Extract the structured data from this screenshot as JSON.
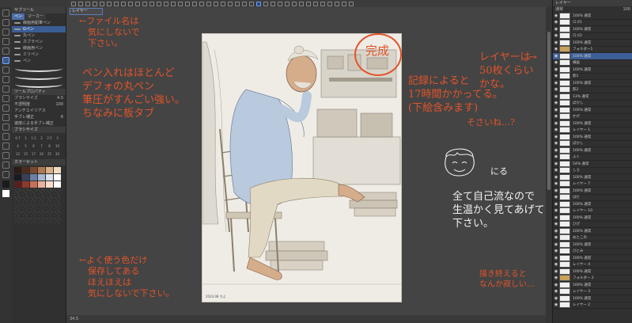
{
  "top_tab": "レイヤー",
  "left_panel": {
    "tab_header": "サブツール",
    "tabs": [
      "ペン",
      "マーカー"
    ],
    "brushes": [
      "線画用鉛筆ペン",
      "Gペン",
      "丸ペン",
      "カブラペン",
      "線画用ペン",
      "ミリペン",
      "ペン"
    ],
    "selected_brush_index": 1,
    "properties_header": "ツールプロパティ",
    "properties": [
      {
        "label": "ブラシサイズ",
        "value": "4.5"
      },
      {
        "label": "不透明度",
        "value": "100"
      },
      {
        "label": "アンチエイリアス",
        "value": ""
      },
      {
        "label": "手ブレ補正",
        "value": "6"
      },
      {
        "label": "速度による手ブレ補正",
        "value": ""
      }
    ],
    "size_header": "ブラシサイズ",
    "sizes": [
      "0.7",
      "1",
      "1.5",
      "2",
      "2.5",
      "3",
      "4",
      "5",
      "6",
      "7",
      "8",
      "10",
      "12",
      "15",
      "17",
      "20",
      "25",
      "30"
    ],
    "palette_header": "カラーセット",
    "swatch_colors": [
      "#2b1b14",
      "#4a2d1e",
      "#7a4a2e",
      "#b07a52",
      "#d8b08a",
      "#f1dcc2",
      "#1a1a22",
      "#3a3f58",
      "#6b7fa4",
      "#a9b8d2",
      "#d9e1ec",
      "#ffffff",
      "#5a1e1e",
      "#8c3a2a",
      "#c7705a",
      "#e8b29c",
      "#f6dccd",
      "#ffffff"
    ]
  },
  "tools_colors": {
    "main": "#1b1b1b",
    "sub": "#ffffff"
  },
  "canvas": {
    "tab_label": "レイヤー",
    "signature": "2024.08 ちよ"
  },
  "annotations": {
    "filename": "←ファイル名は\n　気にしないで\n　下さい。",
    "pens": "ペン入れはほとんど\nデフォの丸ペン\n筆圧がすんごい強い。\nちなみに板タブ",
    "colors": "←よく使う色だけ\n　保存してある\n　ほえほえは\n　気にしないで下さい。",
    "complete": "完成",
    "record": "記録によると\n17時間かかってる。\n(下絵含みます)",
    "suffix": "そさいね…?",
    "layers": "レイヤーは\n50枚くらい\nかな。",
    "smile": "にる",
    "free": "全て自己流なので\n生温かく見てあげて\n下さい。",
    "after": "描き終えると\nなんか寂しい…"
  },
  "status": {
    "zoom": "34.5"
  },
  "layers": [
    {
      "name": "100% 通常",
      "type": "layer"
    },
    {
      "name": "ロゴ1",
      "type": "layer"
    },
    {
      "name": "100% 通常",
      "type": "layer"
    },
    {
      "name": "ロゴ2",
      "type": "layer"
    },
    {
      "name": "100% 通常",
      "type": "layer"
    },
    {
      "name": "フォルダー1",
      "type": "folder"
    },
    {
      "name": "100% 通常",
      "type": "layer"
    },
    {
      "name": "線画",
      "type": "layer"
    },
    {
      "name": "100% 通常",
      "type": "layer"
    },
    {
      "name": "影1",
      "type": "layer"
    },
    {
      "name": "100% 通常",
      "type": "layer"
    },
    {
      "name": "影2",
      "type": "layer"
    },
    {
      "name": "13% 通常",
      "type": "layer"
    },
    {
      "name": "ぼかし",
      "type": "layer"
    },
    {
      "name": "100% 通常",
      "type": "layer"
    },
    {
      "name": "かげ",
      "type": "layer"
    },
    {
      "name": "100% 通常",
      "type": "layer"
    },
    {
      "name": "レイヤー 1",
      "type": "layer"
    },
    {
      "name": "100% 通常",
      "type": "layer"
    },
    {
      "name": "ぼかし",
      "type": "layer"
    },
    {
      "name": "100% 通常",
      "type": "layer"
    },
    {
      "name": "ふく",
      "type": "layer"
    },
    {
      "name": "54% 通常",
      "type": "layer"
    },
    {
      "name": "しろ",
      "type": "layer"
    },
    {
      "name": "100% 通常",
      "type": "layer"
    },
    {
      "name": "レイヤー 7",
      "type": "layer"
    },
    {
      "name": "100% 通常",
      "type": "layer"
    },
    {
      "name": "はだ",
      "type": "layer"
    },
    {
      "name": "100% 通常",
      "type": "layer"
    },
    {
      "name": "レイヤー 10",
      "type": "layer"
    },
    {
      "name": "100% 通常",
      "type": "layer"
    },
    {
      "name": "ひげ",
      "type": "layer"
    },
    {
      "name": "100% 通常",
      "type": "layer"
    },
    {
      "name": "おとこの",
      "type": "layer"
    },
    {
      "name": "100% 通常",
      "type": "layer"
    },
    {
      "name": "ひとみ",
      "type": "layer"
    },
    {
      "name": "100% 通常",
      "type": "layer"
    },
    {
      "name": "レイヤー 4",
      "type": "layer"
    },
    {
      "name": "100% 通常",
      "type": "layer"
    },
    {
      "name": "フォルダー 2",
      "type": "folder"
    },
    {
      "name": "100% 通常",
      "type": "layer"
    },
    {
      "name": "レイヤー 3",
      "type": "layer"
    },
    {
      "name": "100% 通常",
      "type": "layer"
    },
    {
      "name": "レイヤー 2",
      "type": "layer"
    }
  ],
  "selected_layer_index": 6,
  "right_header": {
    "blend": "通常",
    "opacity": "100"
  }
}
